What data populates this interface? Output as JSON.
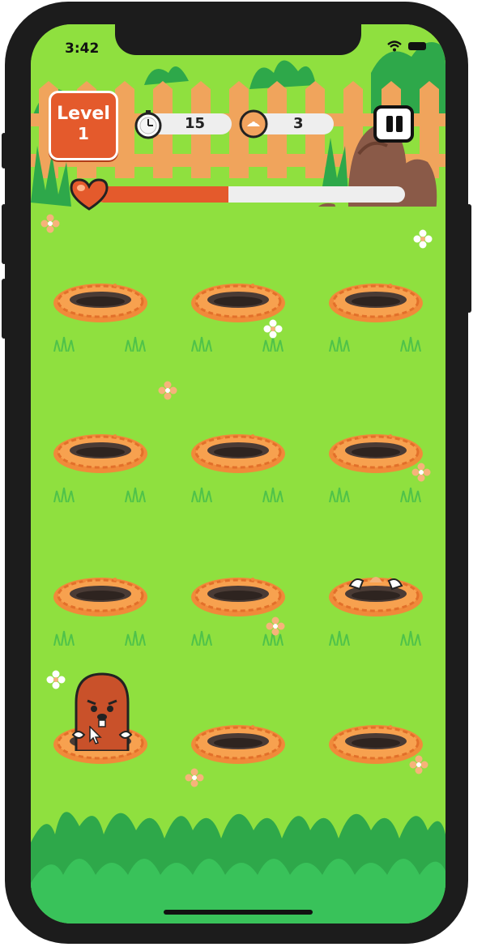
{
  "status_bar": {
    "time": "3:42"
  },
  "hud": {
    "level_label": "Level",
    "level_number": "1",
    "timer_value": "15",
    "score_value": "3",
    "health_fraction": 0.43
  },
  "board": {
    "rows": 4,
    "cols": 3,
    "moles": [
      {
        "row": 3,
        "col": 0,
        "state": "up"
      },
      {
        "row": 2,
        "col": 2,
        "state": "emerging"
      }
    ]
  },
  "colors": {
    "grass": "#8fe03f",
    "fence": "#f0a45c",
    "accent": "#e45a2c",
    "dirt": "#f08a3a"
  },
  "icons": {
    "timer": "stopwatch-icon",
    "score": "mole-coin-icon",
    "pause": "pause-icon",
    "health": "heart-icon"
  }
}
